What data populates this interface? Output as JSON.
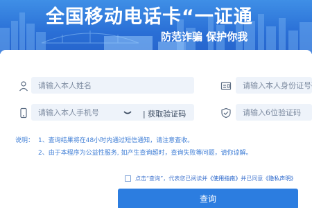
{
  "banner": {
    "title": "全国移动电话卡“一证通",
    "subtitle": "防范诈骗 保护你我"
  },
  "form": {
    "name_placeholder": "请输入本人姓名",
    "id_placeholder": "请输入本人身份证号码",
    "phone_placeholder": "请输入本人手机号",
    "get_code_label": "| 获取验证码",
    "code_placeholder": "请输入6位验证码"
  },
  "notes": {
    "label": "说明：",
    "item1": "1、查询结果将在48小时内通过短信通知，请注意查收。",
    "item2": "2、由于本程序为公益性服务, 如产生查询超时，查询失败等问题，请你谅解。"
  },
  "agreement": {
    "prefix": "点击“查询”，代表您已阅读并",
    "guide_link": "《使用指南》",
    "middle": "并已同意",
    "privacy_link": "《隐私声明》"
  },
  "submit_label": "查询",
  "icons": [
    "user-icon",
    "id-card-icon",
    "phone-icon",
    "toggle-chevron-icon",
    "shield-check-icon"
  ],
  "colors": {
    "brand_blue": "#2c7de0",
    "banner_blue": "#2a6fd6",
    "field_bg": "#eef3fa",
    "note_blue": "#3f7ed6"
  }
}
